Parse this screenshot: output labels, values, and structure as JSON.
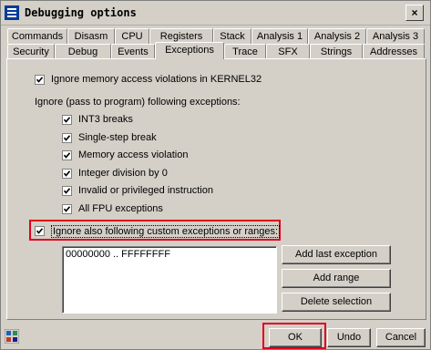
{
  "window": {
    "title": "Debugging options",
    "close_glyph": "×",
    "title_icon": "list-icon"
  },
  "tabs_row1": [
    "Commands",
    "Disasm",
    "CPU",
    "Registers",
    "Stack",
    "Analysis 1",
    "Analysis 2",
    "Analysis 3"
  ],
  "tabs_row2": [
    "Security",
    "Debug",
    "Events",
    "Exceptions",
    "Trace",
    "SFX",
    "Strings",
    "Addresses"
  ],
  "active_tab": "Exceptions",
  "options": {
    "ignore_kernel32": {
      "label": "Ignore memory access violations in KERNEL32",
      "checked": true
    },
    "pass_group_label": "Ignore (pass to program) following exceptions:",
    "exceptions": [
      {
        "label": "INT3 breaks",
        "checked": true
      },
      {
        "label": "Single-step break",
        "checked": true
      },
      {
        "label": "Memory access violation",
        "checked": true
      },
      {
        "label": "Integer division by 0",
        "checked": true
      },
      {
        "label": "Invalid or privileged instruction",
        "checked": true
      },
      {
        "label": "All FPU exceptions",
        "checked": true
      }
    ],
    "custom": {
      "label": "Ignore also following custom exceptions or ranges:",
      "checked": true
    }
  },
  "custom_ranges": [
    "00000000 .. FFFFFFFF"
  ],
  "side_buttons": {
    "add_last": "Add last exception",
    "add_range": "Add range",
    "delete": "Delete selection"
  },
  "footer": {
    "ok": "OK",
    "undo": "Undo",
    "cancel": "Cancel",
    "status_icon": "palette-icon"
  },
  "colors": {
    "highlight": "#e0001b",
    "face": "#d4d0c8"
  }
}
